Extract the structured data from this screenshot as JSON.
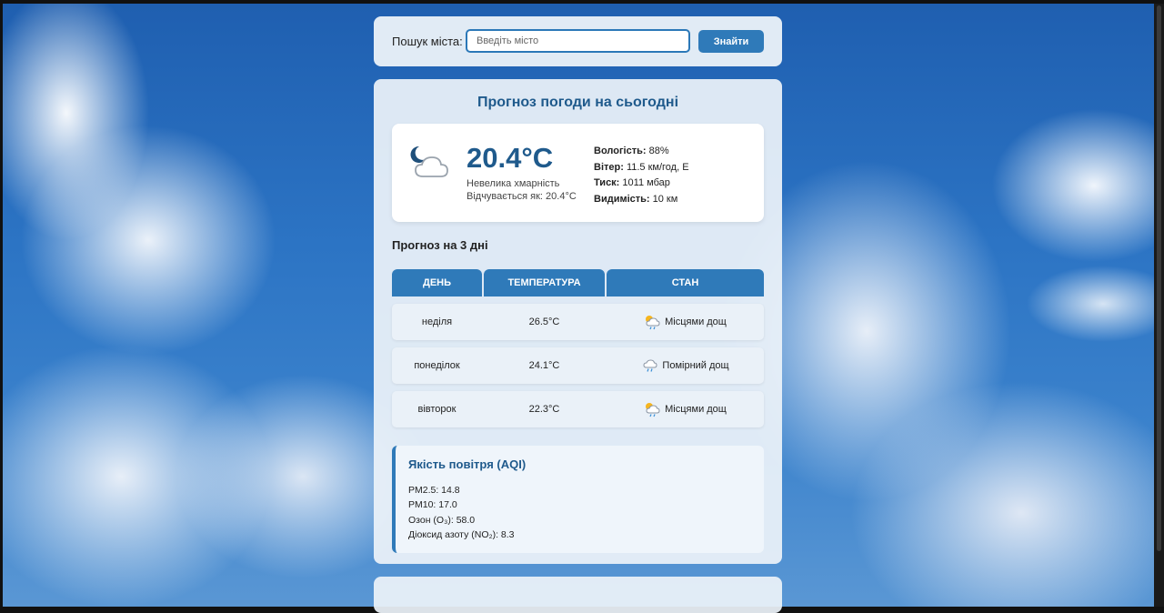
{
  "search": {
    "label": "Пошук міста:",
    "placeholder": "Введіть місто",
    "button": "Знайти"
  },
  "today": {
    "title": "Прогноз погоди на сьогодні",
    "icon": "cloud-moon-icon",
    "temperature": "20.4°C",
    "description": "Невелика хмарність",
    "feels_like": "Відчувається як: 20.4°C",
    "details": [
      {
        "label": "Вологість:",
        "value": "88%"
      },
      {
        "label": "Вітер:",
        "value": "11.5 км/год, E"
      },
      {
        "label": "Тиск:",
        "value": "1011 мбар"
      },
      {
        "label": "Видимість:",
        "value": "10 км"
      }
    ]
  },
  "forecast": {
    "title": "Прогноз на 3 дні",
    "headers": [
      "ДЕНЬ",
      "ТЕМПЕРАТУРА",
      "СТАН"
    ],
    "rows": [
      {
        "day": "неділя",
        "temp": "26.5°C",
        "condition": "Місцями дощ",
        "icon": "patchy-rain-icon"
      },
      {
        "day": "понеділок",
        "temp": "24.1°C",
        "condition": "Помірний дощ",
        "icon": "moderate-rain-icon"
      },
      {
        "day": "вівторок",
        "temp": "22.3°C",
        "condition": "Місцями дощ",
        "icon": "patchy-rain-icon"
      }
    ]
  },
  "aqi": {
    "title": "Якість повітря (AQI)",
    "items": [
      "PM2.5: 14.8",
      "PM10: 17.0",
      "Озон (O₃): 58.0",
      "Діоксид азоту (NO₂): 8.3"
    ]
  },
  "colors": {
    "accent": "#2f7ab9",
    "title": "#1f5a8c"
  }
}
